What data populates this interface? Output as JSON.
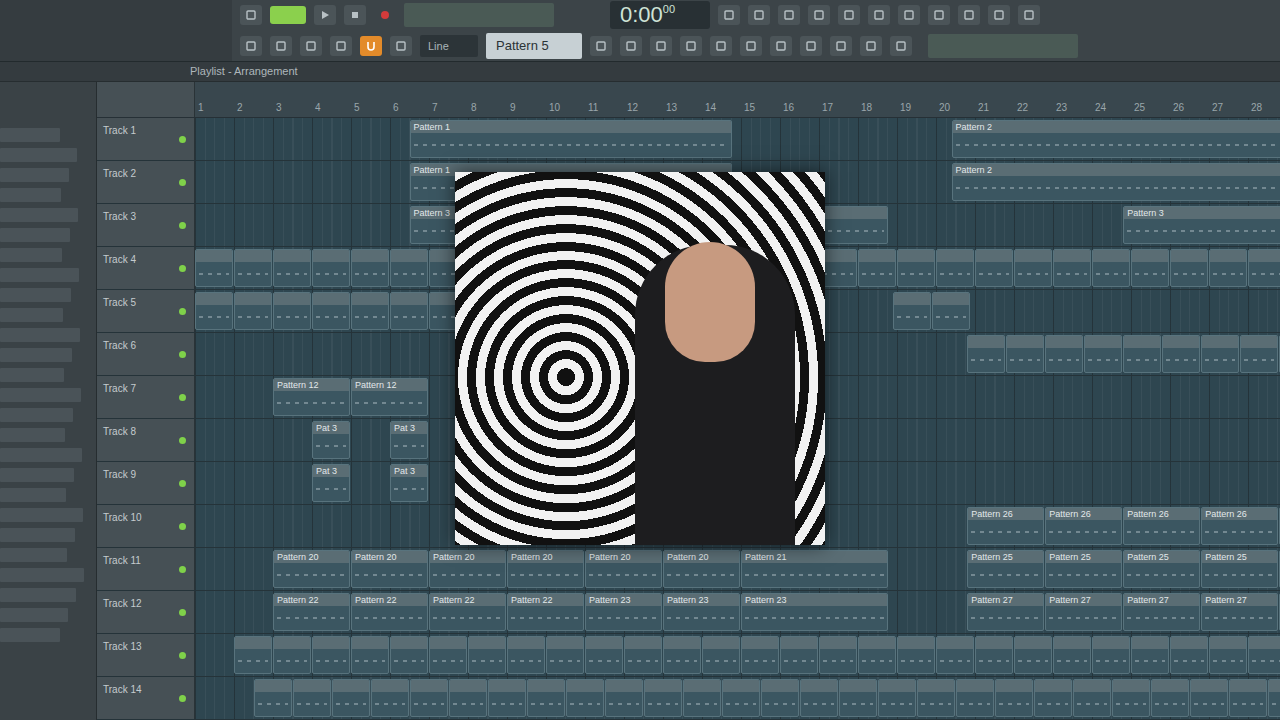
{
  "toolbar": {
    "time": "0:00",
    "time_fraction": "00",
    "snap": "Line",
    "pattern": "Pattern 5",
    "magnet_on": true
  },
  "playlist": {
    "title": "Playlist - Arrangement"
  },
  "ruler": [
    "1",
    "2",
    "3",
    "4",
    "5",
    "6",
    "7",
    "8",
    "9",
    "10",
    "11",
    "12",
    "13",
    "14",
    "15",
    "16",
    "17",
    "18",
    "19",
    "20",
    "21",
    "22",
    "23",
    "24",
    "25",
    "26",
    "27",
    "28"
  ],
  "tracks": [
    {
      "name": "Track 1",
      "enabled": true,
      "clips": [
        {
          "label": "Pattern 1",
          "bar": 5.5,
          "bars": 8.3,
          "count": 1
        },
        {
          "label": "Pattern 2",
          "bar": 19.4,
          "bars": 8.6,
          "count": 1
        }
      ]
    },
    {
      "name": "Track 2",
      "enabled": true,
      "clips": [
        {
          "label": "Pattern 1",
          "bar": 5.5,
          "bars": 8.3,
          "count": 1
        },
        {
          "label": "Pattern 2",
          "bar": 19.4,
          "bars": 8.6,
          "count": 1
        }
      ]
    },
    {
      "name": "Track 3",
      "enabled": true,
      "clips": [
        {
          "label": "Pattern 3",
          "bar": 5.5,
          "bars": 12.3,
          "count": 1
        },
        {
          "label": "Pattern 3",
          "bar": 23.8,
          "bars": 4.2,
          "count": 1
        }
      ]
    },
    {
      "name": "Track 4",
      "enabled": true,
      "clips": [
        {
          "bar": 0,
          "bars": 1,
          "count": 28
        }
      ]
    },
    {
      "name": "Track 5",
      "enabled": true,
      "clips": [
        {
          "bar": 0,
          "bars": 1,
          "count": 7
        },
        {
          "bar": 17.9,
          "bars": 1,
          "count": 2
        }
      ]
    },
    {
      "name": "Track 6",
      "enabled": true,
      "clips": [
        {
          "bar": 19.8,
          "bars": 1,
          "count": 9
        }
      ]
    },
    {
      "name": "Track 7",
      "enabled": true,
      "clips": [
        {
          "label": "Pattern 12",
          "bar": 2,
          "bars": 2,
          "count": 2
        }
      ]
    },
    {
      "name": "Track 8",
      "enabled": true,
      "clips": [
        {
          "label": "Pat 3",
          "bar": 3,
          "bars": 1,
          "count": 1
        },
        {
          "label": "Pat 3",
          "bar": 5,
          "bars": 1,
          "count": 1
        }
      ]
    },
    {
      "name": "Track 9",
      "enabled": true,
      "clips": [
        {
          "label": "Pat 3",
          "bar": 3,
          "bars": 1,
          "count": 1
        },
        {
          "label": "Pat 3",
          "bar": 5,
          "bars": 1,
          "count": 1
        }
      ]
    },
    {
      "name": "Track 10",
      "enabled": true,
      "clips": [
        {
          "label": "Pattern 26",
          "bar": 19.8,
          "bars": 2,
          "count": 5
        }
      ]
    },
    {
      "name": "Track 11",
      "enabled": true,
      "clips": [
        {
          "label": "Pattern 20",
          "bar": 2,
          "bars": 2,
          "count": 6
        },
        {
          "label": "Pattern 21",
          "bar": 14,
          "bars": 3.8,
          "count": 1
        },
        {
          "label": "Pattern 25",
          "bar": 19.8,
          "bars": 2,
          "count": 5
        }
      ]
    },
    {
      "name": "Track 12",
      "enabled": true,
      "clips": [
        {
          "label": "Pattern 22",
          "bar": 2,
          "bars": 2,
          "count": 4
        },
        {
          "label": "Pattern 23",
          "bar": 10,
          "bars": 2,
          "count": 2
        },
        {
          "label": "Pattern 23",
          "bar": 14,
          "bars": 3.8,
          "count": 1
        },
        {
          "label": "Pattern 27",
          "bar": 19.8,
          "bars": 2,
          "count": 5
        }
      ]
    },
    {
      "name": "Track 13",
      "enabled": true,
      "clips": [
        {
          "bar": 1,
          "bars": 1,
          "count": 27
        }
      ]
    },
    {
      "name": "Track 14",
      "enabled": true,
      "clips": [
        {
          "bar": 1.5,
          "bars": 1,
          "count": 27
        }
      ]
    }
  ]
}
